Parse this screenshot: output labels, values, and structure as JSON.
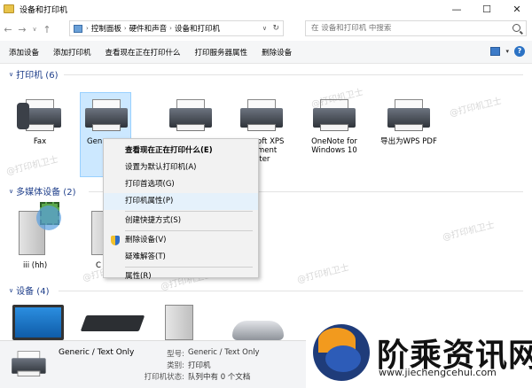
{
  "window": {
    "title": "设备和打印机",
    "buttons": {
      "minimize": "—",
      "maximize": "☐",
      "close": "✕"
    }
  },
  "address": {
    "back": "←",
    "forward": "→",
    "recent": "∨",
    "up": "↑",
    "crumbs": [
      "控制面板",
      "硬件和声音",
      "设备和打印机"
    ],
    "sep": "›",
    "dropdown": "∨",
    "refresh": "↻",
    "search_placeholder": "在 设备和打印机 中搜索"
  },
  "commands": [
    "添加设备",
    "添加打印机",
    "查看现在正在打印什么",
    "打印服务器属性",
    "删除设备"
  ],
  "toolbar_right": {
    "view_dropdown": "▾",
    "help": "?"
  },
  "groups": {
    "printers": {
      "title": "打印机 (6)",
      "chevron": "∨"
    },
    "multimedia": {
      "title": "多媒体设备 (2)",
      "chevron": "∨"
    },
    "devices": {
      "title": "设备 (4)",
      "chevron": "∨"
    }
  },
  "printers": [
    {
      "label": "Fax",
      "icon": "fax-icon"
    },
    {
      "label": "Generic / Text Only",
      "icon": "printer-icon",
      "selected": true
    },
    {
      "label": "",
      "icon": "printer-icon"
    },
    {
      "label": "Microsoft XPS Document Writer",
      "icon": "printer-icon"
    },
    {
      "label": "OneNote for Windows 10",
      "icon": "printer-icon"
    },
    {
      "label": "导出为WPS PDF",
      "icon": "printer-icon"
    }
  ],
  "printer_visible_labels": {
    "fax": "Fax",
    "generic": "Gen",
    "xps_l1": "oft XPS",
    "xps_l2": "ment",
    "xps_l3": "iter",
    "onenote_l1": "OneNote for",
    "onenote_l2": "Windows 10",
    "wps": "导出为WPS PDF"
  },
  "multimedia": [
    {
      "label": "iii (hh)",
      "icon": "media-server-icon"
    },
    {
      "label": "C",
      "icon": "media-server-icon"
    }
  ],
  "context_menu": {
    "items": [
      {
        "label": "查看现在正在打印什么(E)",
        "bold": true
      },
      {
        "label": "设置为默认打印机(A)"
      },
      {
        "label": "打印首选项(G)"
      },
      {
        "label": "打印机属性(P)",
        "hover": true
      },
      {
        "label": "创建快捷方式(S)"
      },
      {
        "label": "删除设备(V)",
        "icon": "shield-icon"
      },
      {
        "label": "疑难解答(T)"
      },
      {
        "label": "属性(R)"
      }
    ]
  },
  "status": {
    "name": "Generic / Text Only",
    "model_key": "型号:",
    "model_val": "Generic / Text Only",
    "category_key": "类别:",
    "category_val": "打印机",
    "state_key": "打印机状态:",
    "state_val": "队列中有 0 个文档"
  },
  "watermark": "@打印机卫士",
  "brand": {
    "name": "阶乘资讯网",
    "url": "www.jiechengcehui.com",
    "colors": {
      "navy": "#1f3c7a",
      "orange": "#f29a1e"
    }
  }
}
